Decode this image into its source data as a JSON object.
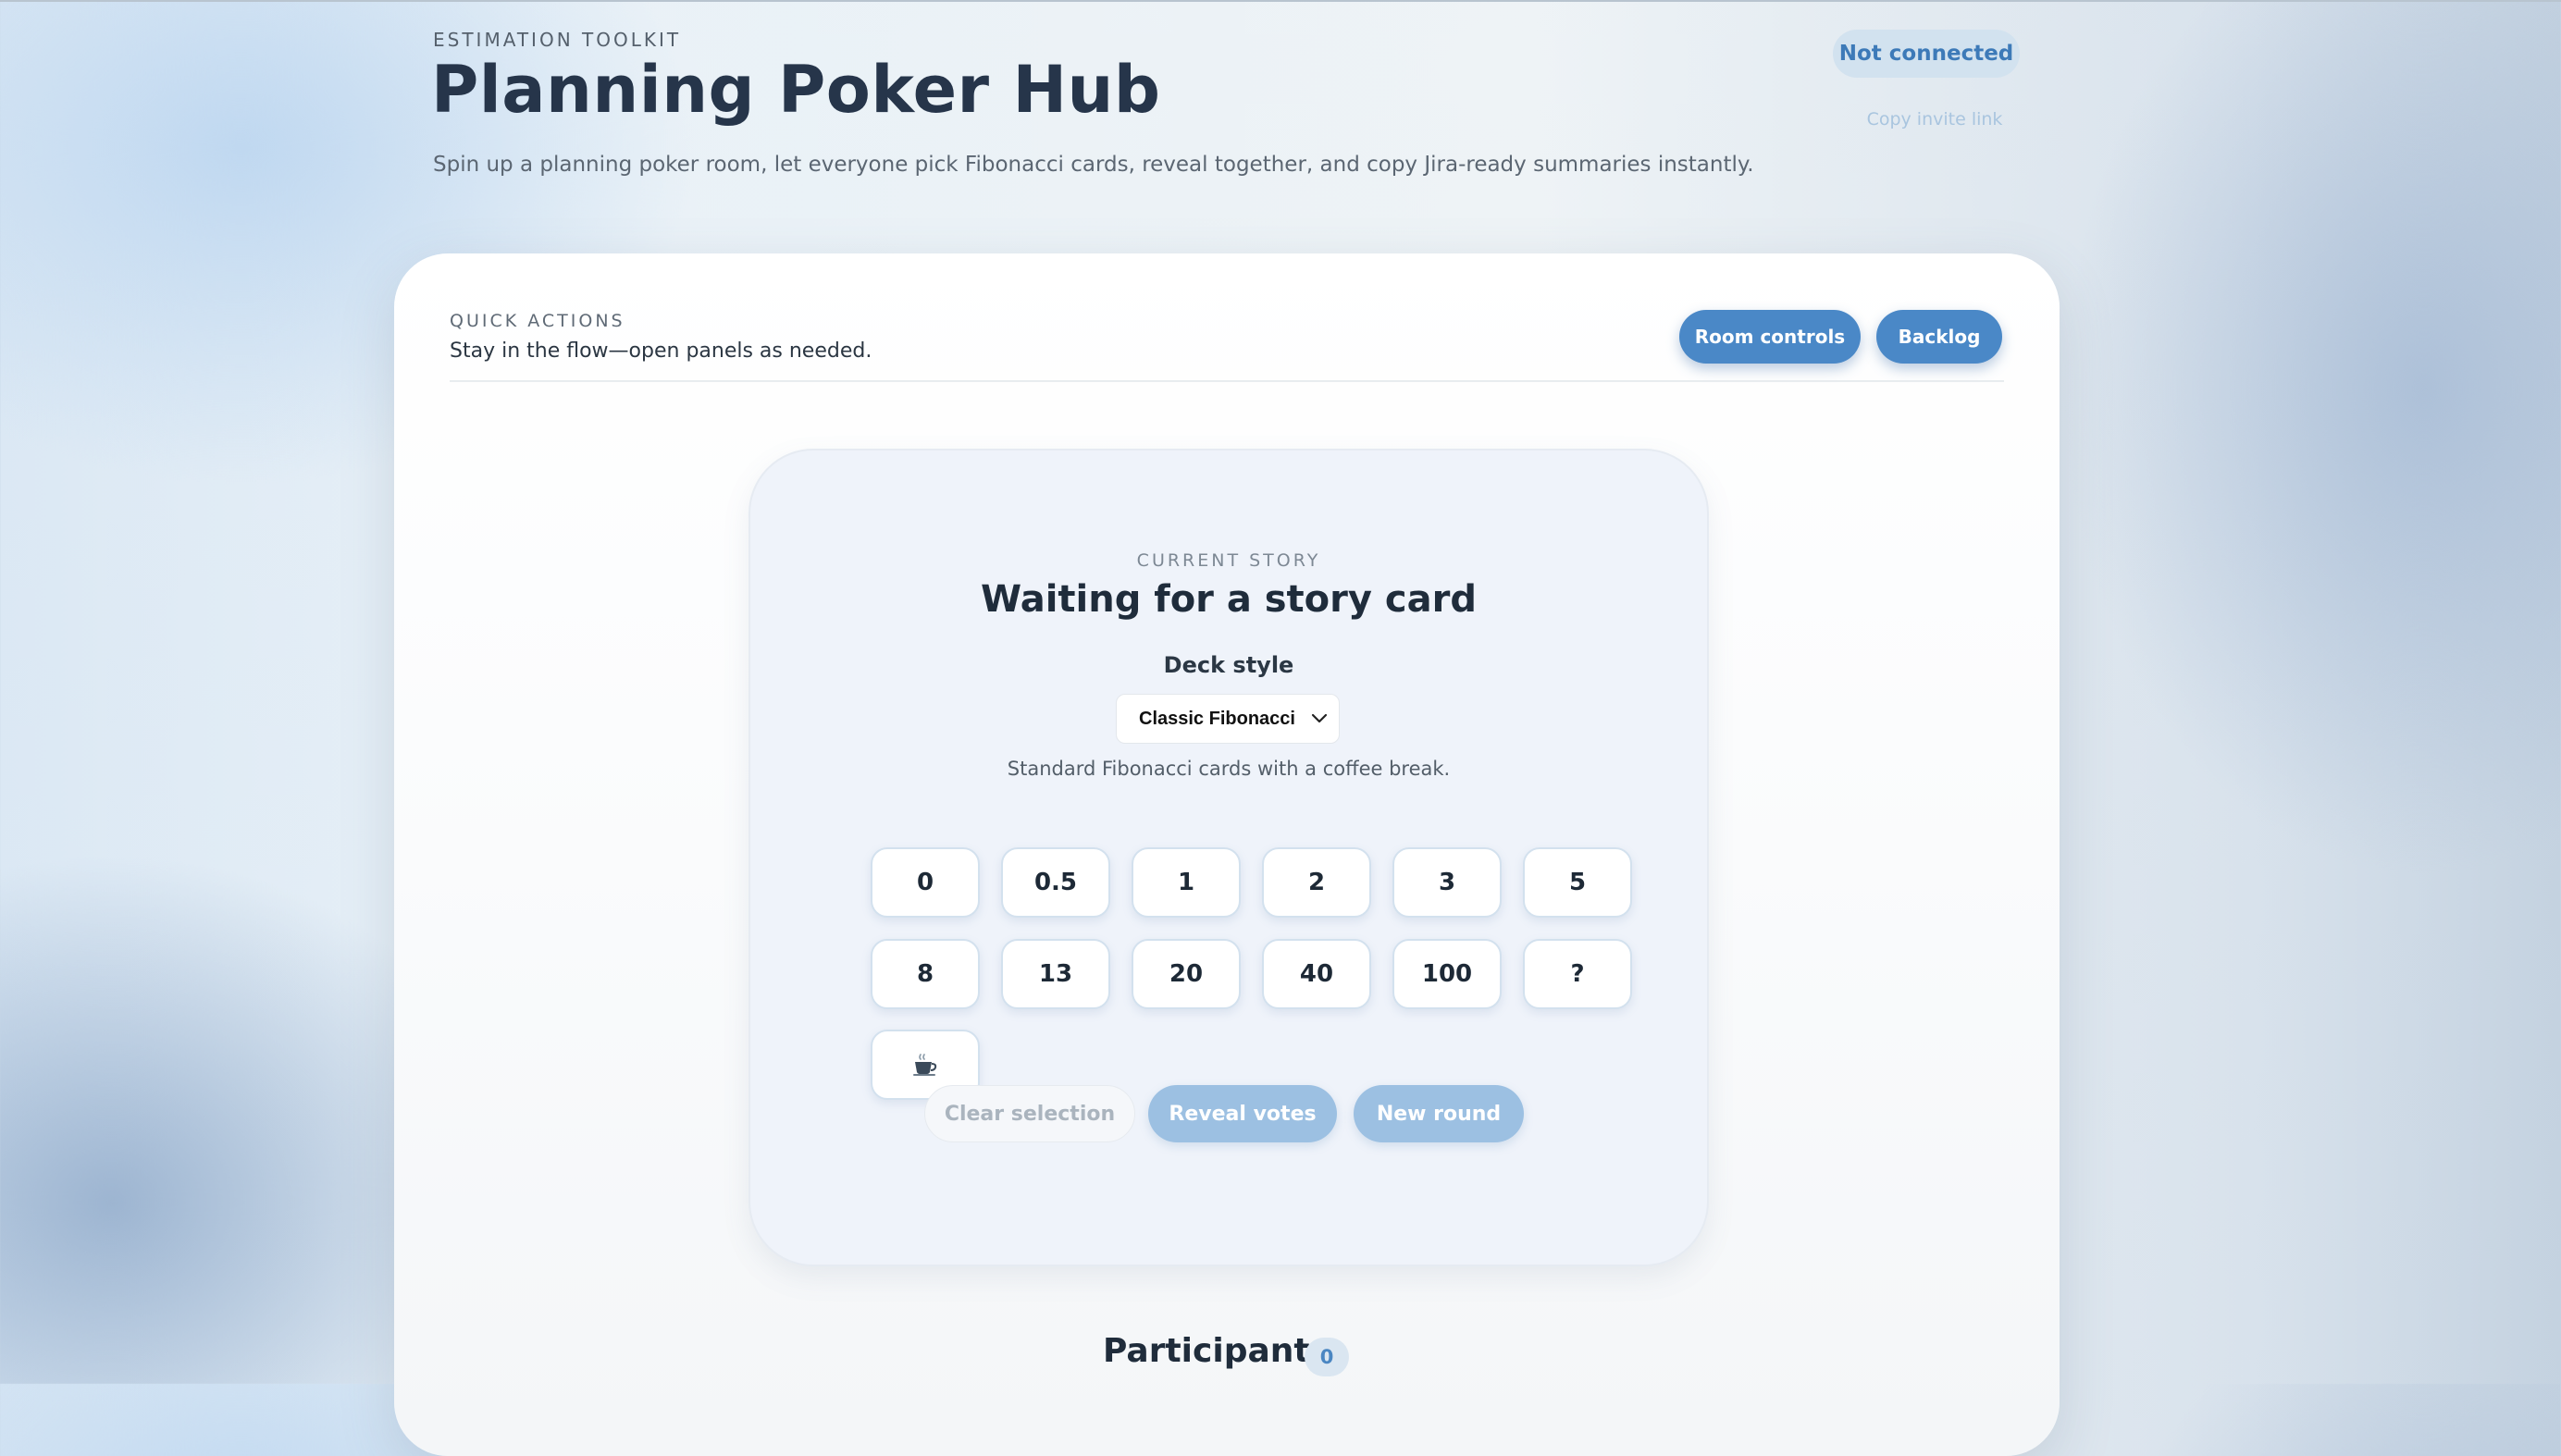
{
  "header": {
    "eyebrow": "ESTIMATION TOOLKIT",
    "title": "Planning Poker Hub",
    "subtitle": "Spin up a planning poker room, let everyone pick Fibonacci cards, reveal together, and copy Jira-ready summaries instantly.",
    "status": "Not connected",
    "invite_link": "Copy invite link"
  },
  "quick_actions": {
    "eyebrow": "QUICK ACTIONS",
    "description": "Stay in the flow—open panels as needed.",
    "room_controls": "Room controls",
    "backlog": "Backlog"
  },
  "story": {
    "eyebrow": "CURRENT STORY",
    "title": "Waiting for a story card",
    "deck_label": "Deck style",
    "deck_selected": "Classic Fibonacci",
    "deck_description": "Standard Fibonacci cards with a coffee break.",
    "cards": [
      "0",
      "0.5",
      "1",
      "2",
      "3",
      "5",
      "8",
      "13",
      "20",
      "40",
      "100",
      "?",
      "☕"
    ],
    "clear_selection": "Clear selection",
    "reveal_votes": "Reveal votes",
    "new_round": "New round"
  },
  "participants": {
    "title": "Participants",
    "count": "0"
  },
  "colors": {
    "accent": "#4a88c7",
    "disabled_accent": "#9cc0e2",
    "status_text": "#3d7ab8"
  }
}
